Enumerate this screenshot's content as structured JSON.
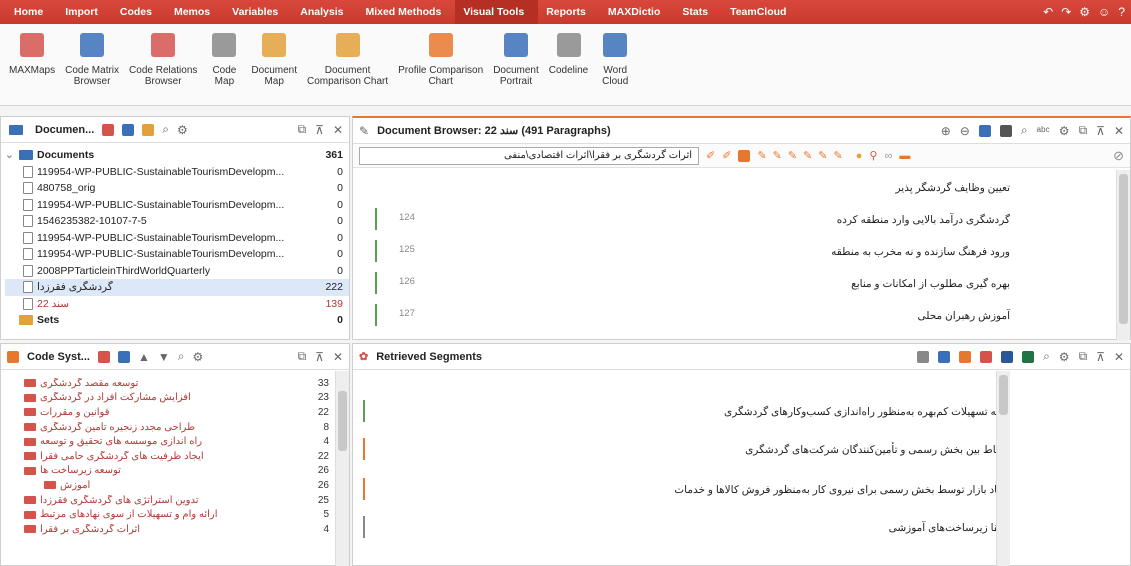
{
  "menu": [
    "Home",
    "Import",
    "Codes",
    "Memos",
    "Variables",
    "Analysis",
    "Mixed Methods",
    "Visual Tools",
    "Reports",
    "MAXDictio",
    "Stats",
    "TeamCloud"
  ],
  "menu_active_index": 7,
  "ribbon": [
    {
      "label": "MAXMaps",
      "icon": "maxmaps-icon"
    },
    {
      "label": "Code Matrix\nBrowser",
      "icon": "code-matrix-icon"
    },
    {
      "label": "Code Relations\nBrowser",
      "icon": "code-relations-icon"
    },
    {
      "label": "Code\nMap",
      "icon": "code-map-icon"
    },
    {
      "label": "Document\nMap",
      "icon": "document-map-icon"
    },
    {
      "label": "Document\nComparison Chart",
      "icon": "comparison-chart-icon"
    },
    {
      "label": "Profile Comparison\nChart",
      "icon": "profile-chart-icon"
    },
    {
      "label": "Document\nPortrait",
      "icon": "portrait-icon"
    },
    {
      "label": "Codeline",
      "icon": "codeline-icon"
    },
    {
      "label": "Word\nCloud",
      "icon": "word-cloud-icon"
    }
  ],
  "documents_panel": {
    "title": "Documen...",
    "root": {
      "label": "Documents",
      "count": "361"
    },
    "items": [
      {
        "label": "119954-WP-PUBLIC-SustainableTourismDevelopm...",
        "count": "0"
      },
      {
        "label": "480758_orig",
        "count": "0"
      },
      {
        "label": "119954-WP-PUBLIC-SustainableTourismDevelopm...",
        "count": "0"
      },
      {
        "label": "1546235382-10107-7-5",
        "count": "0"
      },
      {
        "label": "119954-WP-PUBLIC-SustainableTourismDevelopm...",
        "count": "0"
      },
      {
        "label": "119954-WP-PUBLIC-SustainableTourismDevelopm...",
        "count": "0"
      },
      {
        "label": "2008PPTarticleinThirdWorldQuarterly",
        "count": "0"
      },
      {
        "label": "گردشگری فقرزدا",
        "count": "222"
      },
      {
        "label": "سند 22",
        "count": "139"
      }
    ],
    "sets": {
      "label": "Sets",
      "count": "0"
    }
  },
  "code_system": {
    "title": "Code Syst...",
    "items": [
      {
        "label": "توسعه مقصد گردشگری",
        "count": "33"
      },
      {
        "label": "افزایش مشارکت افراد در گردشگری",
        "count": "23"
      },
      {
        "label": "قوانین و مقررات",
        "count": "22"
      },
      {
        "label": "طراحی مجدد زنجیره تامین گردشگری",
        "count": "8"
      },
      {
        "label": "راه اندازی موسسه های تحقیق و توسعه",
        "count": "4"
      },
      {
        "label": "ایجاد ظرفیت های گردشگری حامی فقرا",
        "count": "22"
      },
      {
        "label": "توسعه زیرساخت ها",
        "count": "26"
      },
      {
        "label": "آموزش",
        "count": "26"
      },
      {
        "label": "تدوین استراتژی های گردشگری فقرزدا",
        "count": "25"
      },
      {
        "label": "ارائه وام و تسهیلات از سوی نهادهای مرتبط",
        "count": "5"
      },
      {
        "label": "اثرات گردشگری بر فقرا",
        "count": "4"
      }
    ]
  },
  "doc_browser": {
    "title": "Document Browser: سند 22   (491 Paragraphs)",
    "combo": "اثرات گردشگری بر فقرا\\اثرات اقتصادی\\منفی",
    "paragraphs": [
      {
        "num": "",
        "text": "تعیین وظایف گردشگر پذیر"
      },
      {
        "num": "124",
        "text": "گردشگری درآمد بالایی وارد منطقه کرده"
      },
      {
        "num": "125",
        "text": "ورود فرهنگ سازنده و نه مخرب به منطقه"
      },
      {
        "num": "126",
        "text": "بهره گیری مطلوب از امکانات و منابع"
      },
      {
        "num": "127",
        "text": "آموزش رهبران محلی"
      }
    ]
  },
  "retrieved": {
    "title": "Retrieved Segments",
    "segments": [
      "ارائه تسهیلات کم‌بهره به‌منظور راه‌اندازی کسب‌وکارهای گردشگری",
      "ارتباط بین بخش رسمی و تأمین‌کنندگان شرکت‌های گردشگری",
      "ایجاد بازار توسط بخش رسمی برای نیروی کار به‌منظور فروش کالاها و خدمات",
      "ارتقا زیرساخت‌های آموزشی"
    ]
  },
  "colors": {
    "menubar": "#c93a2e",
    "accent": "#e8772e",
    "code": "#b23a38",
    "selection": "#dce8f8"
  }
}
